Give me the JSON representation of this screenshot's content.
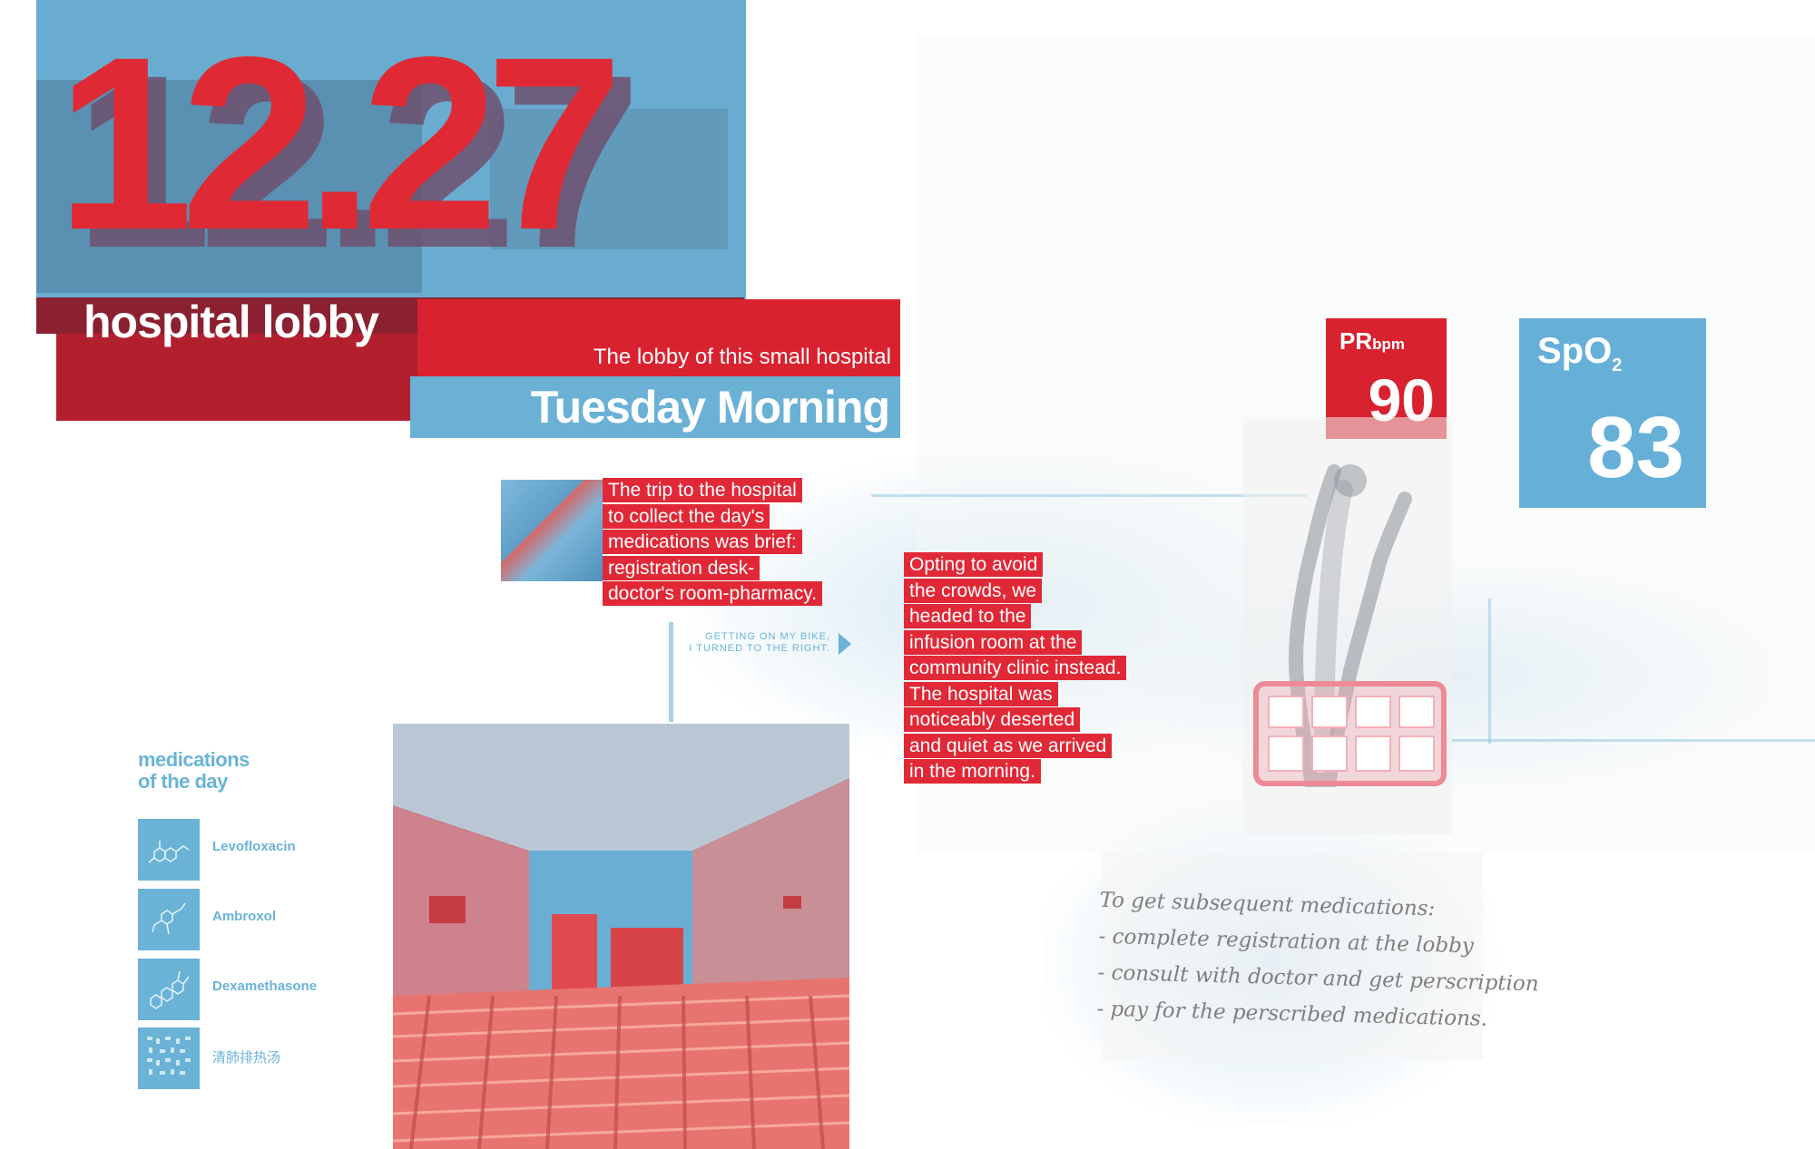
{
  "header": {
    "date": "12.27",
    "location": "hospital lobby",
    "description": "The lobby of this small hospital",
    "day_time": "Tuesday Morning"
  },
  "vitals": {
    "pr": {
      "label": "PR",
      "unit": "bpm",
      "value": "90"
    },
    "spo2": {
      "label": "SpO",
      "subscript": "2",
      "value": "83"
    }
  },
  "captions": {
    "trip": [
      "The trip to the hospital",
      "to collect the day's",
      "medications was brief:",
      "registration desk-",
      "doctor's room-pharmacy."
    ],
    "clinic": [
      "Opting to avoid",
      "the crowds, we",
      "headed to the",
      "infusion room at the",
      "community clinic instead.",
      "The hospital was",
      "noticeably deserted",
      "and quiet as we arrived",
      "in the morning."
    ]
  },
  "route_note": [
    "GETTING ON MY BIKE,",
    "I TURNED TO THE RIGHT."
  ],
  "medications": {
    "heading": [
      "medications",
      "of the day"
    ],
    "items": [
      {
        "name": "Levofloxacin",
        "icon": "molecule-icon"
      },
      {
        "name": "Ambroxol",
        "icon": "molecule-icon"
      },
      {
        "name": "Dexamethasone",
        "icon": "molecule-icon"
      },
      {
        "name": "清肺排热汤",
        "icon": "herbal-grid-icon"
      }
    ]
  },
  "note": {
    "lines": [
      "To get subsequent medications:",
      "- complete registration at the lobby",
      "- consult with doctor and get perscription",
      "- pay for the perscribed medications."
    ]
  },
  "colors": {
    "red": "#df2a35",
    "blue": "#6ab3d6",
    "dark_red": "#b2202e"
  }
}
